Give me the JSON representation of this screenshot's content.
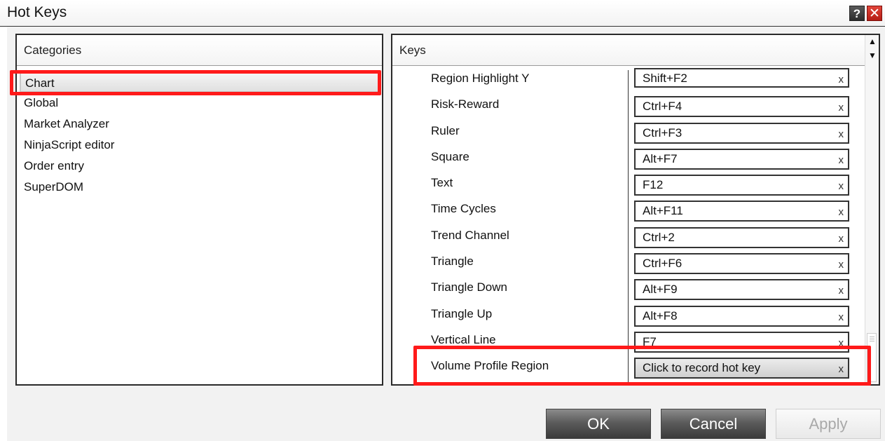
{
  "window": {
    "title": "Hot Keys",
    "help_label": "?",
    "close_label": "✕"
  },
  "categories": {
    "header": "Categories",
    "items": [
      {
        "label": "Chart",
        "selected": true
      },
      {
        "label": "Global"
      },
      {
        "label": "Market Analyzer"
      },
      {
        "label": "NinjaScript editor"
      },
      {
        "label": "Order entry"
      },
      {
        "label": "SuperDOM"
      }
    ]
  },
  "keys": {
    "header": "Keys",
    "clear_label": "x",
    "rows": [
      {
        "name": "Region Highlight Y",
        "key": "Shift+F2"
      },
      {
        "name": "Risk-Reward",
        "key": "Ctrl+F4"
      },
      {
        "name": "Ruler",
        "key": "Ctrl+F3"
      },
      {
        "name": "Square",
        "key": "Alt+F7"
      },
      {
        "name": "Text",
        "key": "F12"
      },
      {
        "name": "Time Cycles",
        "key": "Alt+F11"
      },
      {
        "name": "Trend Channel",
        "key": "Ctrl+2"
      },
      {
        "name": "Triangle",
        "key": "Ctrl+F6"
      },
      {
        "name": "Triangle Down",
        "key": "Alt+F9"
      },
      {
        "name": "Triangle Up",
        "key": "Alt+F8"
      },
      {
        "name": "Vertical Line",
        "key": "F7"
      },
      {
        "name": "Volume Profile Region",
        "key": "Click to record hot key"
      }
    ]
  },
  "buttons": {
    "ok": "OK",
    "cancel": "Cancel",
    "apply": "Apply"
  },
  "colors": {
    "highlight": "#ff1a1a"
  }
}
